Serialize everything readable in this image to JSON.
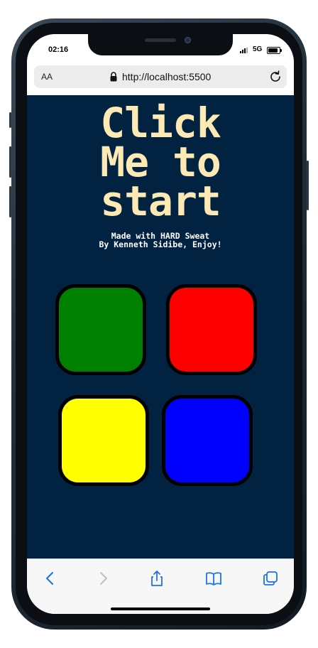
{
  "status_bar": {
    "time": "02:16",
    "network": "5G"
  },
  "browser": {
    "text_size_label": "AA",
    "url": "http://localhost:5500"
  },
  "page": {
    "title_lines": [
      "Click",
      "Me to",
      "start"
    ],
    "subtitle_lines": [
      "Made with HARD Sweat",
      "By Kenneth Sidibe, Enjoy!"
    ],
    "pads": [
      {
        "name": "green",
        "color": "#008000"
      },
      {
        "name": "red",
        "color": "#ff0000"
      },
      {
        "name": "yellow",
        "color": "#ffff00"
      },
      {
        "name": "blue",
        "color": "#0000ff"
      }
    ],
    "background_color": "#012241",
    "title_color": "#fde9b4"
  },
  "toolbar": {
    "icons": [
      "back-icon",
      "forward-icon",
      "share-icon",
      "bookmarks-icon",
      "tabs-icon"
    ]
  }
}
